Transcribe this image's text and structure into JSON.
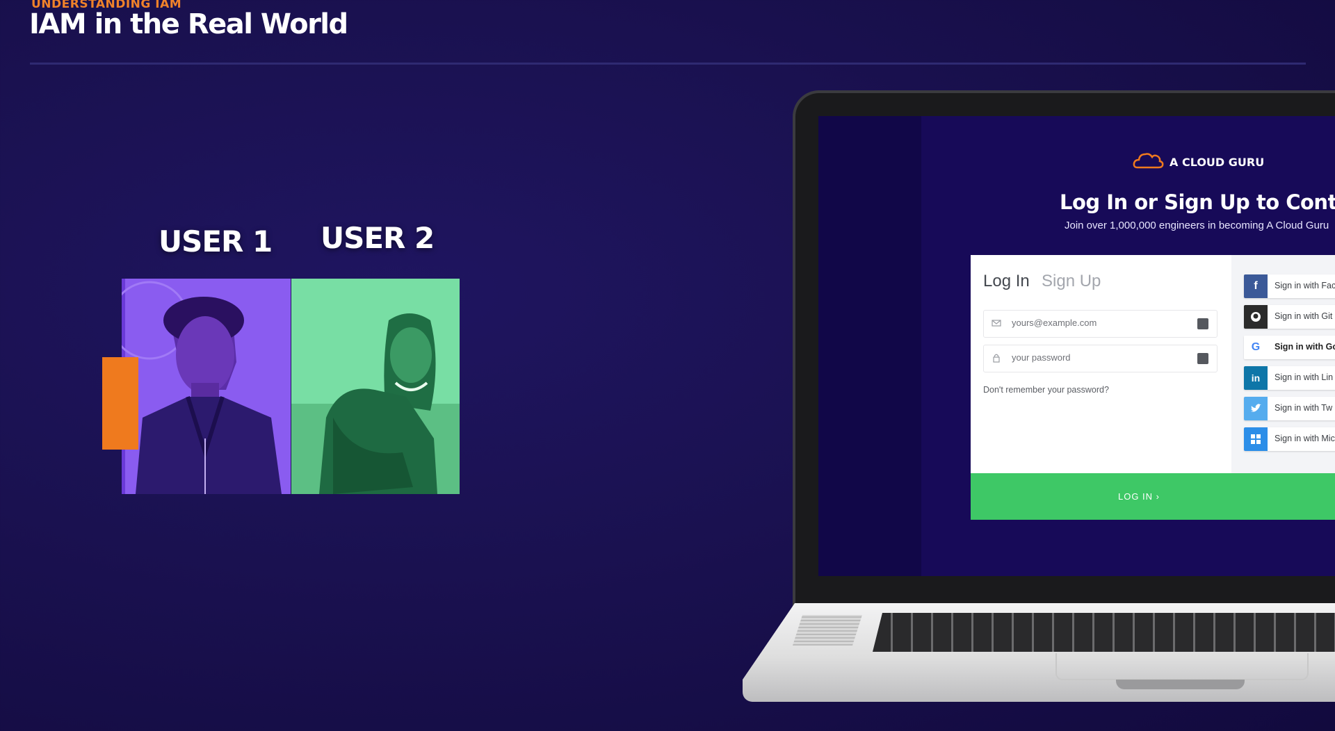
{
  "slide": {
    "eyebrow": "UNDERSTANDING IAM",
    "title": "IAM in the Real World"
  },
  "users": [
    {
      "label": "USER 1",
      "tint": "#8a5cf0"
    },
    {
      "label": "USER 2",
      "tint": "#6fdc9c"
    }
  ],
  "login_page": {
    "brand": "A CLOUD GURU",
    "headline": "Log In or Sign Up to Continue",
    "subline": "Join over 1,000,000 engineers in becoming A Cloud Guru",
    "tabs": {
      "login": "Log In",
      "signup": "Sign Up"
    },
    "email_placeholder": "yours@example.com",
    "password_placeholder": "your password",
    "forgot": "Don't remember your password?",
    "social": [
      {
        "label": "Sign in with Fac",
        "icon": "facebook-icon",
        "color": "#3b5998",
        "glyph": "f"
      },
      {
        "label": "Sign in with Git",
        "icon": "github-icon",
        "color": "#2b2b2b",
        "glyph": "●"
      },
      {
        "label": "Sign in with Go",
        "icon": "google-icon",
        "color": "#ffffff",
        "glyph": "G"
      },
      {
        "label": "Sign in with Lin",
        "icon": "linkedin-icon",
        "color": "#0e76a8",
        "glyph": "in"
      },
      {
        "label": "Sign in with Tw",
        "icon": "twitter-icon",
        "color": "#55acee",
        "glyph": "t"
      },
      {
        "label": "Sign in with Mic",
        "icon": "microsoft-icon",
        "color": "#2c8ee8",
        "glyph": "▦"
      }
    ],
    "login_button": "LOG IN ›"
  },
  "colors": {
    "background": "#1a1150",
    "accent_orange": "#ef7a1e",
    "login_green": "#3ec866"
  }
}
